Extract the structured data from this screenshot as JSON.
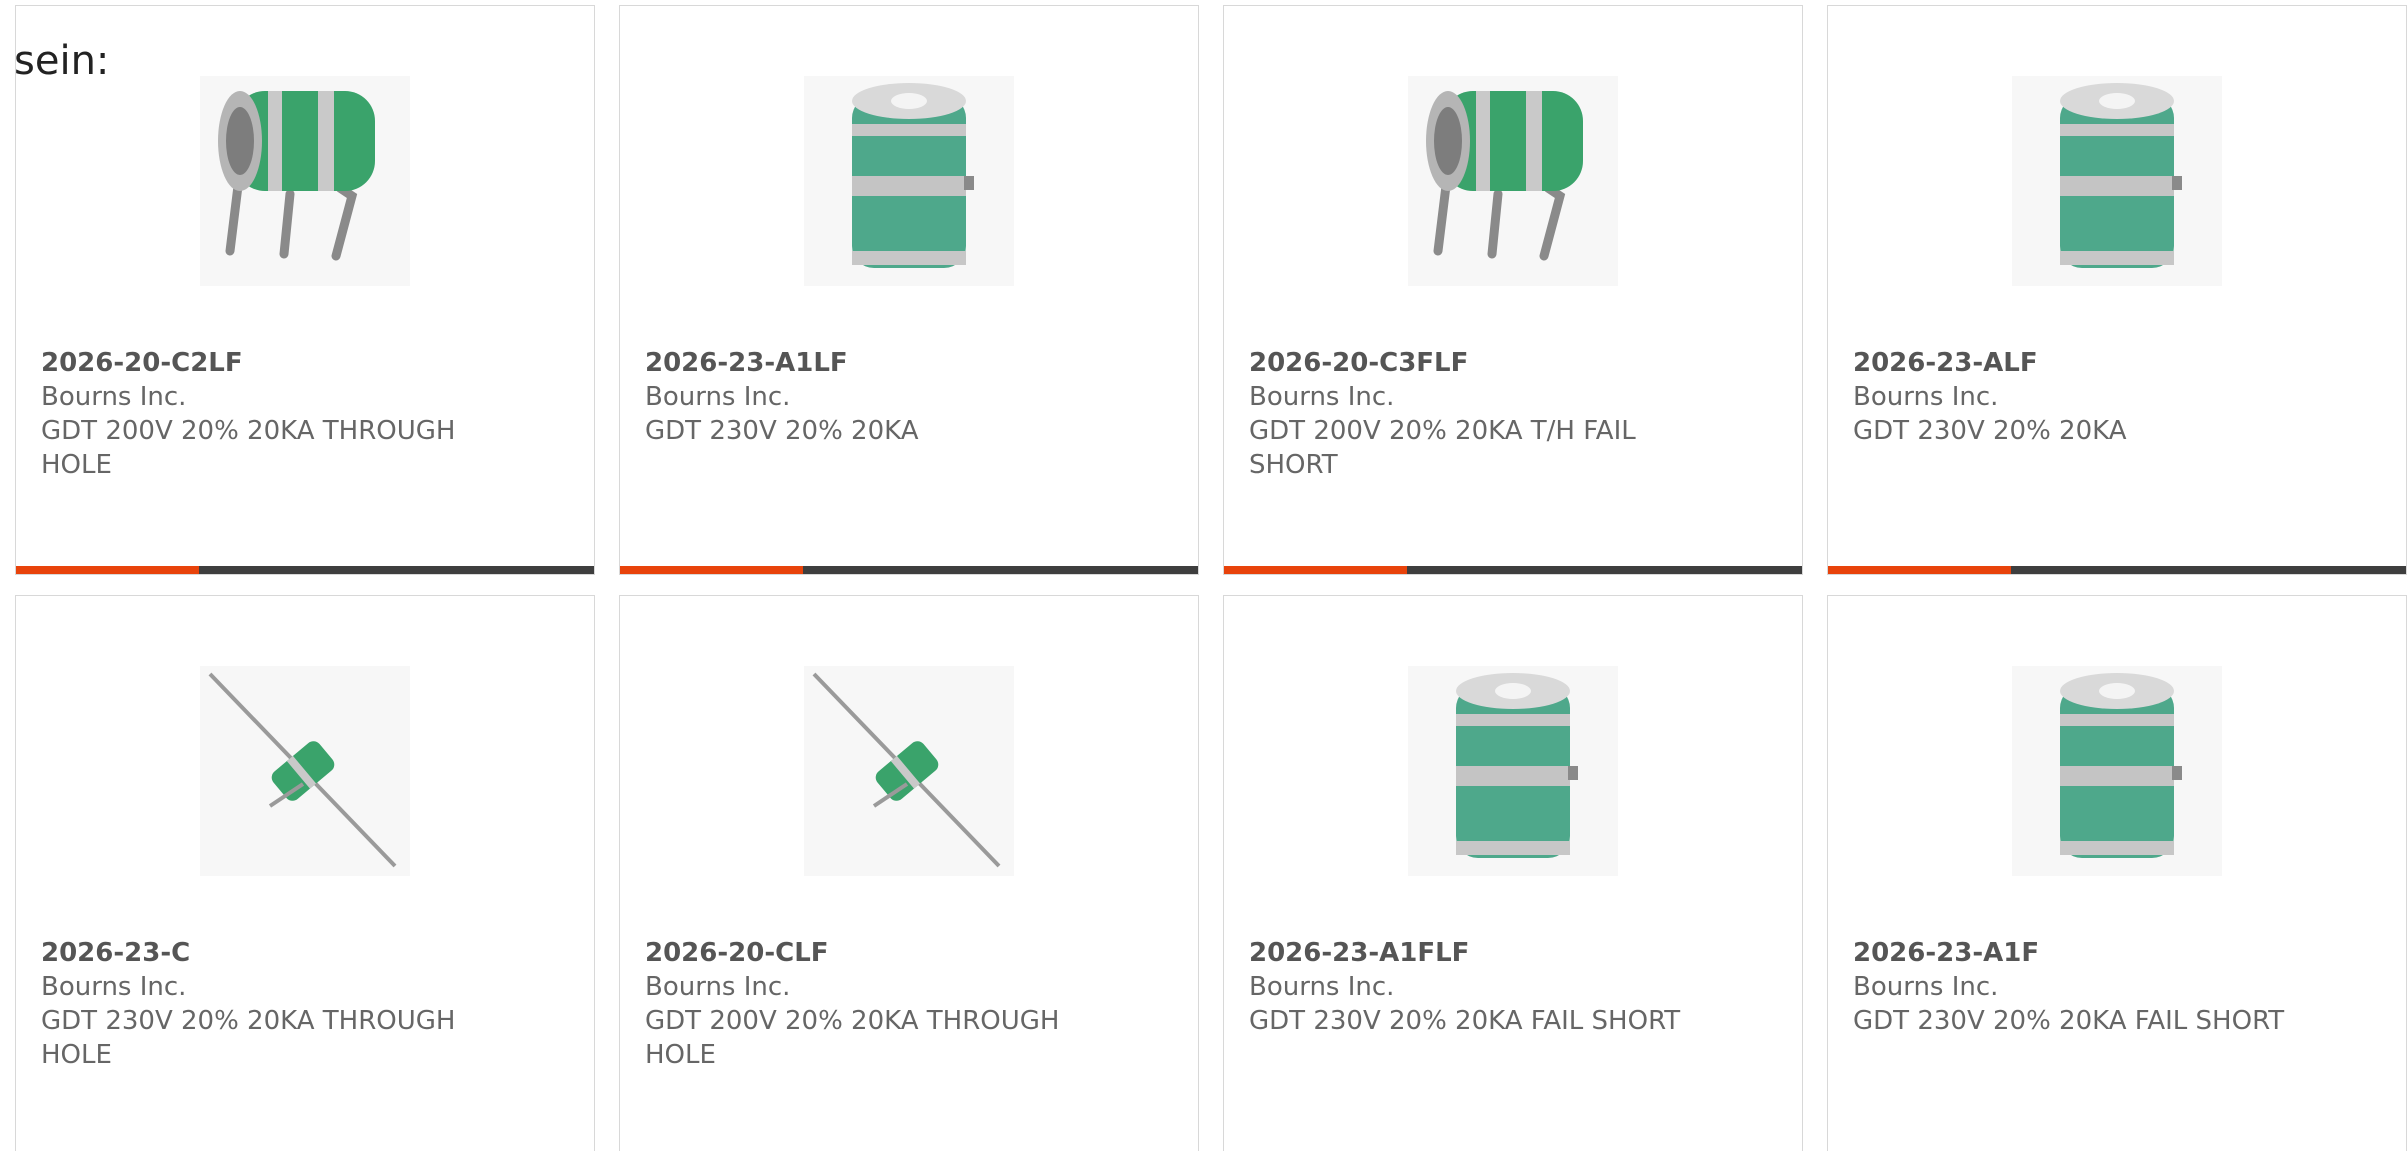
{
  "intro": {
    "text": "sein:"
  },
  "colors": {
    "accent": "#e8430b",
    "bar": "#3e3e3e",
    "component_green": "#3aa36b",
    "component_teal": "#4ea88b"
  },
  "products": [
    {
      "part": "2026-20-C2LF",
      "manufacturer": "Bourns Inc.",
      "description": "GDT 200V 20% 20KA THROUGH HOLE",
      "image_icon": "gdt-3-lead-icon"
    },
    {
      "part": "2026-23-A1LF",
      "manufacturer": "Bourns Inc.",
      "description": "GDT 230V 20% 20KA",
      "image_icon": "gdt-cylinder-icon"
    },
    {
      "part": "2026-20-C3FLF",
      "manufacturer": "Bourns Inc.",
      "description": "GDT 200V 20% 20KA T/H FAIL SHORT",
      "image_icon": "gdt-3-lead-icon"
    },
    {
      "part": "2026-23-ALF",
      "manufacturer": "Bourns Inc.",
      "description": "GDT 230V 20% 20KA",
      "image_icon": "gdt-cylinder-icon"
    },
    {
      "part": "2026-23-C",
      "manufacturer": "Bourns Inc.",
      "description": "GDT 230V 20% 20KA THROUGH HOLE",
      "image_icon": "gdt-axial-icon"
    },
    {
      "part": "2026-20-CLF",
      "manufacturer": "Bourns Inc.",
      "description": "GDT 200V 20% 20KA THROUGH HOLE",
      "image_icon": "gdt-axial-icon"
    },
    {
      "part": "2026-23-A1FLF",
      "manufacturer": "Bourns Inc.",
      "description": "GDT 230V 20% 20KA FAIL SHORT",
      "image_icon": "gdt-cylinder-icon"
    },
    {
      "part": "2026-23-A1F",
      "manufacturer": "Bourns Inc.",
      "description": "GDT 230V 20% 20KA FAIL SHORT",
      "image_icon": "gdt-cylinder-icon"
    }
  ]
}
